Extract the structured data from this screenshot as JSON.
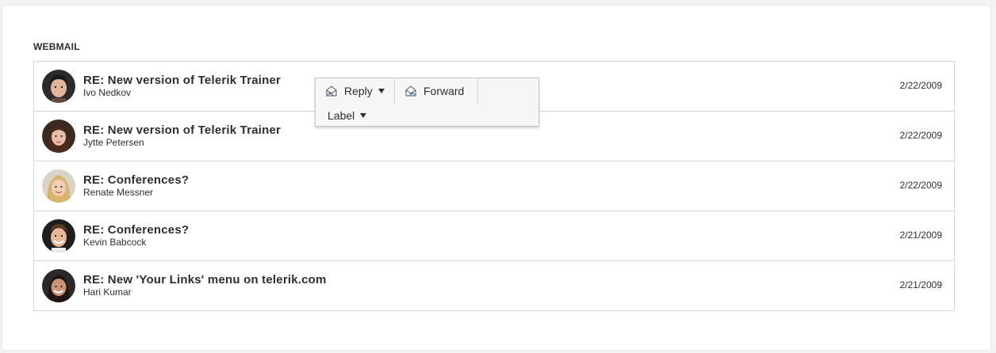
{
  "section": {
    "title": "WEBMAIL"
  },
  "emails": [
    {
      "subject": "RE: New version of Telerik Trainer",
      "sender": "Ivo Nedkov",
      "date": "2/22/2009",
      "avatar": "avatar-man-dark-hair"
    },
    {
      "subject": "RE: New version of Telerik Trainer",
      "sender": "Jytte Petersen",
      "date": "2/22/2009",
      "avatar": "avatar-woman-dark-hair"
    },
    {
      "subject": "RE: Conferences?",
      "sender": "Renate Messner",
      "date": "2/22/2009",
      "avatar": "avatar-woman-blonde"
    },
    {
      "subject": "RE: Conferences?",
      "sender": "Kevin Babcock",
      "date": "2/21/2009",
      "avatar": "avatar-man-smiling"
    },
    {
      "subject": "RE: New 'Your Links' menu on telerik.com",
      "sender": "Hari Kumar",
      "date": "2/21/2009",
      "avatar": "avatar-woman-smiling"
    }
  ],
  "toolbar": {
    "reply_label": "Reply",
    "forward_label": "Forward",
    "label_label": "Label",
    "reply_icon": "reply-mail-icon",
    "forward_icon": "forward-mail-icon",
    "dropdown_icon": "caret-down-icon"
  },
  "colors": {
    "panel_bg": "#ffffff",
    "page_bg": "#f3f3f3",
    "border": "#d5d5d5",
    "toolbar_bg": "#f6f6f6",
    "text": "#2e2e2e"
  }
}
